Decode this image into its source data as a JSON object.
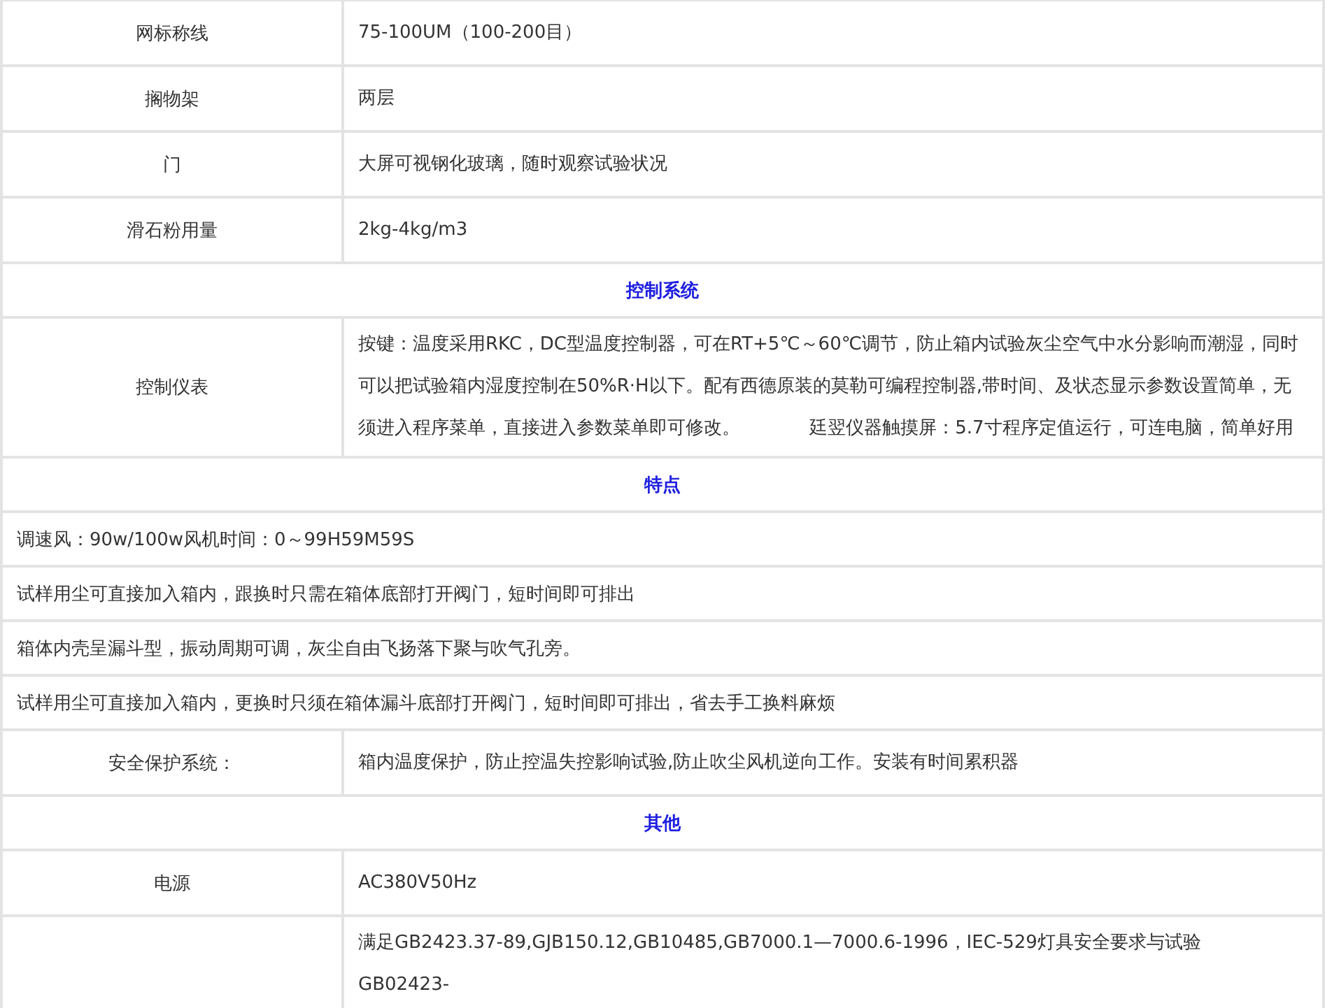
{
  "rows": [
    {
      "kind": "pair",
      "label": "网标称线",
      "value": "75-100UM（100-200目）"
    },
    {
      "kind": "pair",
      "label": "搁物架",
      "value": "两层"
    },
    {
      "kind": "pair",
      "label": "门",
      "value": "大屏可视钢化玻璃，随时观察试验状况"
    },
    {
      "kind": "pair",
      "label": "滑石粉用量",
      "value": "2kg-4kg/m3"
    },
    {
      "kind": "heading",
      "text": "控制系统"
    },
    {
      "kind": "pair",
      "label": "控制仪表",
      "value": "按键：温度采用RKC，DC型温度控制器，可在RT+5℃～60℃调节，防止箱内试验灰尘空气中水分影响而潮湿，同时可以把试验箱内湿度控制在50%R·H以下。配有西德原装的莫勒可编程控制器,带时间、及状态显示参数设置简单，无须进入程序菜单，直接进入参数菜单即可修改。            廷翌仪器触摸屏：5.7寸程序定值运行，可连电脑，简单好用"
    },
    {
      "kind": "heading",
      "text": "特点"
    },
    {
      "kind": "full",
      "text": "调速风：90w/100w风机时间：0～99H59M59S"
    },
    {
      "kind": "full",
      "text": "试样用尘可直接加入箱内，跟换时只需在箱体底部打开阀门，短时间即可排出"
    },
    {
      "kind": "full",
      "text": "箱体内壳呈漏斗型，振动周期可调，灰尘自由飞扬落下聚与吹气孔旁。"
    },
    {
      "kind": "full",
      "text": "试样用尘可直接加入箱内，更换时只须在箱体漏斗底部打开阀门，短时间即可排出，省去手工换料麻烦"
    },
    {
      "kind": "pair",
      "label": "安全保护系统：",
      "value": "箱内温度保护，防止控温失控影响试验,防止吹尘风机逆向工作。安装有时间累积器"
    },
    {
      "kind": "heading",
      "text": "其他"
    },
    {
      "kind": "pair",
      "label": "电源",
      "value": "AC380V50Hz"
    },
    {
      "kind": "pair",
      "value": "满足GB2423.37-89,GJB150.12,GB10485,GB7000.1—7000.6-1996，IEC-529灯具安全要求与试验   GB02423-"
    }
  ]
}
